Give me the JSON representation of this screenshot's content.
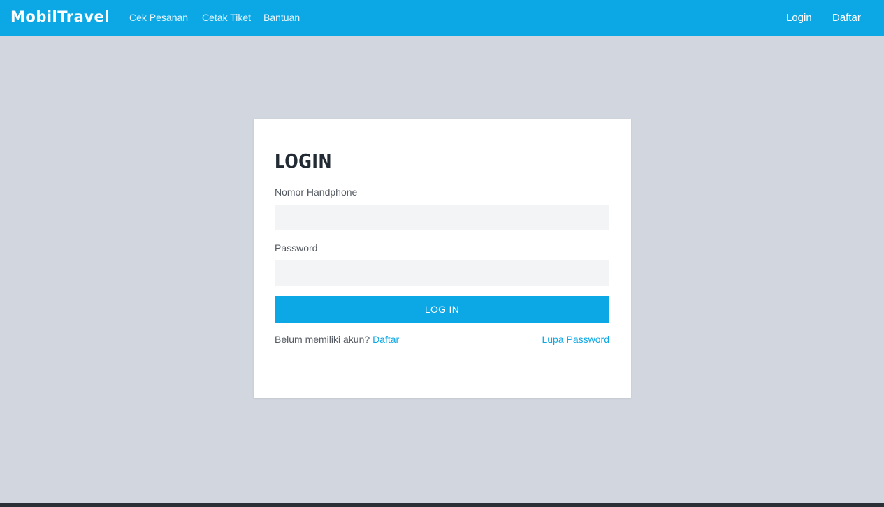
{
  "nav": {
    "logo": "MobilTravel",
    "links": [
      "Cek Pesanan",
      "Cetak Tiket",
      "Bantuan"
    ],
    "login": "Login",
    "register": "Daftar"
  },
  "form": {
    "title": "LOGIN",
    "phone_label": "Nomor Handphone",
    "phone_value": "",
    "password_label": "Password",
    "password_value": "",
    "submit": "LOG IN",
    "no_account": "Belum memiliki akun?",
    "register_link": "Daftar",
    "forgot": "Lupa Password"
  },
  "colors": {
    "accent": "#0ca8e6",
    "background": "#d2d6df",
    "footer": "#2b2f36"
  }
}
